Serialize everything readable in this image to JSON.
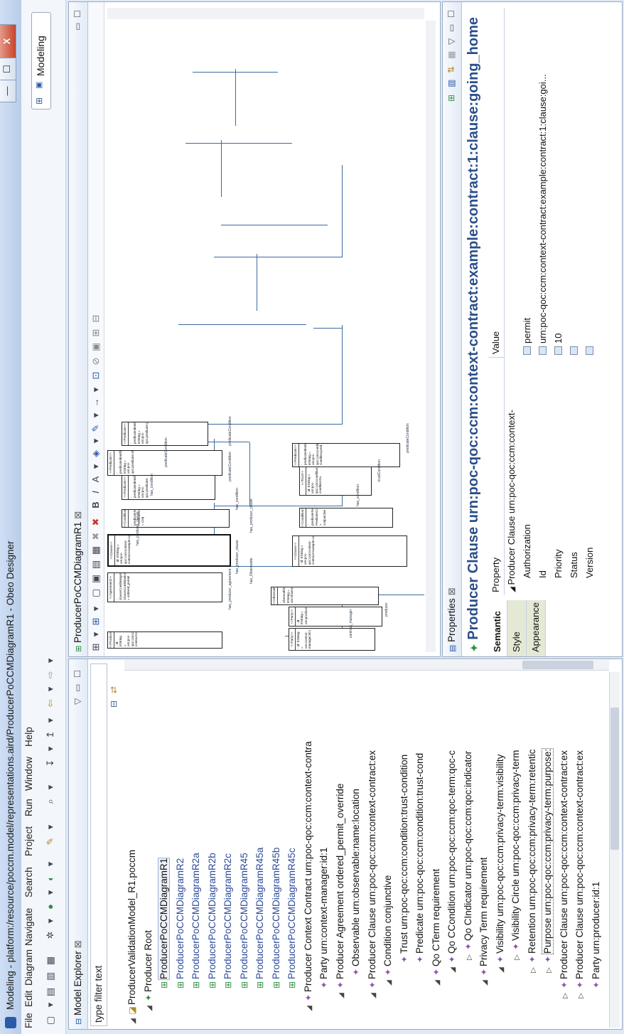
{
  "window": {
    "title": "Modeling - platform:/resource/poccm.model/representations.aird/ProducerPoCCMDiagramR1 - Obeo Designer",
    "min": "—",
    "max": "☐",
    "close": "X"
  },
  "menu": [
    "File",
    "Edit",
    "Diagram",
    "Navigate",
    "Search",
    "Project",
    "Run",
    "Window",
    "Help"
  ],
  "perspective": {
    "label": "Modeling"
  },
  "explorer": {
    "tab_title": "Model Explorer",
    "filter_placeholder": "type filter text",
    "rows": [
      {
        "indent": 0,
        "twisty": "◢",
        "icon": "model-icon",
        "label": "ProducerValidationModel_R1.poccm",
        "style": "normal"
      },
      {
        "indent": 1,
        "twisty": "◢",
        "icon": "root-icon",
        "label": "Producer Root",
        "style": "normal"
      },
      {
        "indent": 2,
        "twisty": "",
        "icon": "diagram-icon",
        "label": "ProducerPoCCMDiagramR1",
        "style": "selected"
      },
      {
        "indent": 2,
        "twisty": "",
        "icon": "diagram-icon",
        "label": "ProducerPoCCMDiagramR2",
        "style": "link"
      },
      {
        "indent": 2,
        "twisty": "",
        "icon": "diagram-icon",
        "label": "ProducerPoCCMDiagramR2a",
        "style": "link"
      },
      {
        "indent": 2,
        "twisty": "",
        "icon": "diagram-icon",
        "label": "ProducerPoCCMDiagramR2b",
        "style": "link"
      },
      {
        "indent": 2,
        "twisty": "",
        "icon": "diagram-icon",
        "label": "ProducerPoCCMDiagramR2c",
        "style": "link"
      },
      {
        "indent": 2,
        "twisty": "",
        "icon": "diagram-icon",
        "label": "ProducerPoCCMDiagramR45",
        "style": "link"
      },
      {
        "indent": 2,
        "twisty": "",
        "icon": "diagram-icon",
        "label": "ProducerPoCCMDiagramR45a",
        "style": "link"
      },
      {
        "indent": 2,
        "twisty": "",
        "icon": "diagram-icon",
        "label": "ProducerPoCCMDiagramR45b",
        "style": "link"
      },
      {
        "indent": 2,
        "twisty": "",
        "icon": "diagram-icon",
        "label": "ProducerPoCCMDiagramR45c",
        "style": "link"
      },
      {
        "indent": 1,
        "twisty": "◢",
        "icon": "element-icon",
        "label": "Producer Context Contract urn:poc-qoc:ccm:context-contra",
        "style": "normal"
      },
      {
        "indent": 2,
        "twisty": "",
        "icon": "element-icon",
        "label": "Party urn:context-manager:id:1",
        "style": "normal"
      },
      {
        "indent": 2,
        "twisty": "◢",
        "icon": "element-icon",
        "label": "Producer Agreement ordered_permit_override",
        "style": "normal"
      },
      {
        "indent": 3,
        "twisty": "",
        "icon": "element-icon",
        "label": "Observable urn:observable:name:location",
        "style": "normal"
      },
      {
        "indent": 2,
        "twisty": "◢",
        "icon": "element-icon",
        "label": "Producer Clause urn:poc-qoc:ccm:context-contract:ex",
        "style": "normal"
      },
      {
        "indent": 3,
        "twisty": "◢",
        "icon": "element-icon",
        "label": "Condition conjunctive",
        "style": "normal"
      },
      {
        "indent": 4,
        "twisty": "",
        "icon": "element-icon",
        "label": "Trust urn:poc-qoc:ccm:condition:trust-condition",
        "style": "normal"
      },
      {
        "indent": 4,
        "twisty": "",
        "icon": "element-icon",
        "label": "Predicate urn:poc-qoc:ccm:condition:trust-cond",
        "style": "normal"
      },
      {
        "indent": 3,
        "twisty": "◢",
        "icon": "element-icon",
        "label": "Qo CTerm requirement",
        "style": "normal"
      },
      {
        "indent": 4,
        "twisty": "◢",
        "icon": "element-icon",
        "label": "Qo CCondition urn:poc-qoc:ccm:qoc-term:qoc-c",
        "style": "normal"
      },
      {
        "indent": 5,
        "twisty": "▷",
        "icon": "element-icon",
        "label": "Qo CIndicator urn:poc-qoc:ccm:qoc:indicator",
        "style": "normal"
      },
      {
        "indent": 3,
        "twisty": "◢",
        "icon": "element-icon",
        "label": "Privacy Term requirement",
        "style": "normal"
      },
      {
        "indent": 4,
        "twisty": "◢",
        "icon": "element-icon",
        "label": "Visibility urn:poc-qoc:ccm:privacy-term:visibility",
        "style": "normal"
      },
      {
        "indent": 5,
        "twisty": "▷",
        "icon": "element-icon",
        "label": "Visibility Circle urn:poc-qoc:ccm:privacy-term",
        "style": "normal"
      },
      {
        "indent": 4,
        "twisty": "▷",
        "icon": "element-icon",
        "label": "Retention urn:poc-qoc:ccm:privacy-term:retentic",
        "style": "normal"
      },
      {
        "indent": 4,
        "twisty": "▷",
        "icon": "element-icon",
        "label": "Purpose urn:poc-qoc:ccm:privacy-term:purpose:",
        "style": "boxed"
      },
      {
        "indent": 2,
        "twisty": "▷",
        "icon": "element-icon",
        "label": "Producer Clause urn:poc-qoc:ccm:context-contract:ex",
        "style": "normal"
      },
      {
        "indent": 2,
        "twisty": "▷",
        "icon": "element-icon",
        "label": "Producer Clause urn:poc-qoc:ccm:context-contract:ex",
        "style": "normal"
      },
      {
        "indent": 2,
        "twisty": "",
        "icon": "element-icon",
        "label": "Party urn:producer:id:1",
        "style": "normal"
      }
    ]
  },
  "editor": {
    "tab_title": "ProducerPoCCMDiagramR1",
    "boxes": [
      {
        "key": "party1",
        "stereo": "<<Party>>",
        "body": "- id: EString = urn:context-manager:id:1"
      },
      {
        "key": "party2",
        "stereo": "<<Party>>",
        "body": "- id: EString = urn:producer:id:1"
      },
      {
        "key": "observable",
        "stereo": "<<Observable>>",
        "body": "- observableName: EString = urn:observable:name:location"
      },
      {
        "key": "clause1",
        "stereo": "<<Clause>>",
        "body": "- id: EString = urn:poc-qoc:ccm:context-contract:example:contract:1:clause:..."
      },
      {
        "key": "condition1",
        "stereo": "<<Condition>>",
        "body": "- predicateSequence: PredicateCombination = conjunctive"
      },
      {
        "key": "trust",
        "stereo": "<<Trust>>",
        "body": "- id: EString = urn:poc-qoc:ccm:condition:trust-condition:tru"
      },
      {
        "key": "predicate1",
        "stereo": "<<Predicate>>",
        "body": "- predicateIdentifier: EString = urn:poc-qoc:ccm:condition:trust-condition:pred"
      },
      {
        "key": "contract",
        "stereo": "<<ProducerContextContract>>",
        "body": "- id: EString = urn:poc-qoc:ccm:context-contract:example:producer:cont"
      },
      {
        "key": "agreement",
        "stereo": "<<Agreement>>",
        "body": "- clauseCombiningAlgorithm: ClauseCombination = ordered_permit"
      },
      {
        "key": "clause2",
        "stereo": "<<Clause>>",
        "body": "- id: EString = urn:poc-qoc:ccm:context-contract:example:contract:1:clause:go"
      },
      {
        "key": "condition2",
        "stereo": "<<Condition>>",
        "body": "- predicateSequence: PredicateCombination = conj"
      },
      {
        "key": "predicate2",
        "stereo": "<<Predicate>>",
        "body": "- predicateIdentifier: EString = urn:poc-qoc:predicate:"
      },
      {
        "key": "predicate3",
        "stereo": "<<Predicate>>",
        "body": "- predicateIdentifier: EString = urn:poc-qoc:predicate:after"
      },
      {
        "key": "predicate4",
        "stereo": "<<Predicate>>",
        "body": "- predicateIdentifier: EString = urn:poc-qoc:predicate:going"
      },
      {
        "key": "clause3",
        "stereo": "<<Clause>>",
        "body": "- id: EString = urn:poc-qoc:ccm:context-contract:example:contract:1:clause:go"
      },
      {
        "key": "condition3",
        "stereo": "<<Condition>>",
        "body": "- predicateSequence: PredicateCombination = conju"
      },
      {
        "key": "predicate5",
        "stereo": "<<Predicate>>",
        "body": "- predicateIdentifier: EString = urn:poc-qoc:predicate:do_ex"
      }
    ],
    "edge_labels": {
      "contract_manager": "contract_manager",
      "producer": "producer",
      "has_observable": "has_Observable",
      "has_producer_clause1": "has_producer_clause",
      "has_condition1": "has_condition",
      "trust_condition": "trustCondition",
      "predicate_condition1": "predicateCondition",
      "has_producer_agreement": "has_producer_agreement",
      "has_producer_clause2": "has_producer_clause",
      "has_condition2": "has_condition",
      "predicate_condition2": "predicateCondition",
      "predicate_condition3": "predicateCondition",
      "has_producer_clause3": "has_producer_clause",
      "has_condition3": "has_condition",
      "predicate_condition4": "predicateCondition"
    }
  },
  "properties": {
    "tab_title": "Properties",
    "heading": "Producer Clause urn:poc-qoc:ccm:context-contract:example:contract:1:clause:going_home",
    "vtabs": [
      "Semantic",
      "Style",
      "Appearance"
    ],
    "col_property": "Property",
    "col_value": "Value",
    "rows": [
      {
        "prop": "Producer Clause urn:poc-qoc:ccm:context-",
        "value": "",
        "group": true
      },
      {
        "prop": "Authorization",
        "value": "permit",
        "group": false
      },
      {
        "prop": "Id",
        "value": "urn:poc-qoc:ccm:context-contract:example:contract:1:clause:goi...",
        "group": false
      },
      {
        "prop": "Priority",
        "value": "10",
        "group": false
      },
      {
        "prop": "Status",
        "value": "",
        "group": false
      },
      {
        "prop": "Version",
        "value": "",
        "group": false
      }
    ]
  },
  "colors": {
    "titlebar": "#c4d6ef",
    "link": "#2b4a9a",
    "edge": "#3d6a9e",
    "heading": "#2a4f8a"
  }
}
